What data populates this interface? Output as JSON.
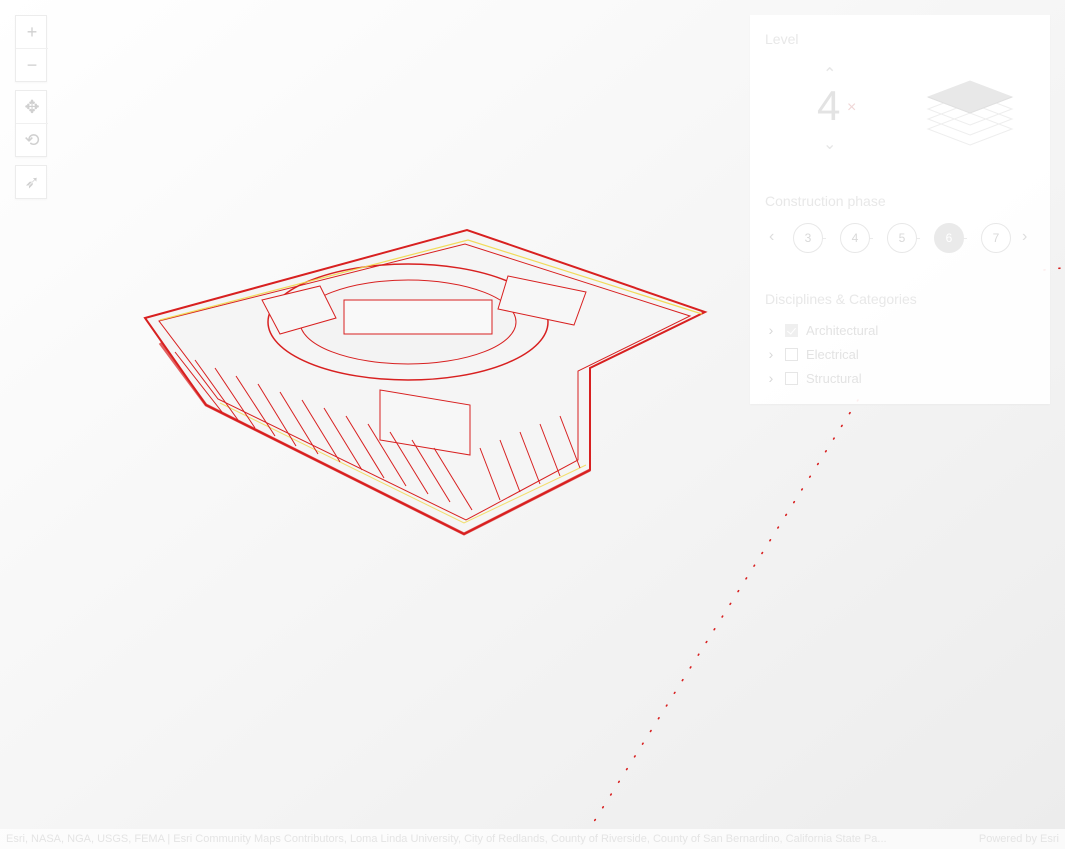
{
  "toolbar": {
    "zoom_in_icon": "plus-icon",
    "zoom_out_icon": "minus-icon",
    "pan_icon": "pan-icon",
    "rotate_icon": "rotate-icon",
    "compass_icon": "compass-icon"
  },
  "panel": {
    "level": {
      "title": "Level",
      "value": "4",
      "clear_symbol": "×",
      "up_symbol": "⌃",
      "down_symbol": "⌄"
    },
    "construction_phase": {
      "title": "Construction phase",
      "prev_symbol": "‹",
      "next_symbol": "›",
      "steps": [
        "3",
        "4",
        "5",
        "6",
        "7"
      ],
      "active_step": "6"
    },
    "disciplines": {
      "title": "Disciplines & Categories",
      "items": [
        {
          "label": "Architectural",
          "checked": true
        },
        {
          "label": "Electrical",
          "checked": false
        },
        {
          "label": "Structural",
          "checked": false
        }
      ]
    }
  },
  "attribution": {
    "text": "Esri, NASA, NGA, USGS, FEMA | Esri Community Maps Contributors, Loma Linda University, City of Redlands, County of Riverside, County of San Bernardino, California State Pa...",
    "powered_by": "Powered by Esri"
  },
  "colors": {
    "building_outline": "#d82020",
    "building_fill": "#f1f1f1",
    "highlight_yellow": "#f1d84a",
    "active_phase": "#eaeaea"
  }
}
